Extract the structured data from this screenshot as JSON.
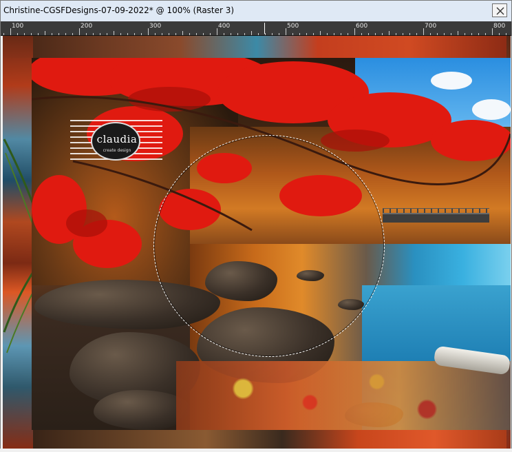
{
  "window": {
    "title": "Christine-CGSFDesigns-07-09-2022* @ 100% (Raster 3)",
    "close_icon": "close-icon"
  },
  "ruler": {
    "labels": [
      "100",
      "200",
      "300",
      "400",
      "500",
      "600",
      "700",
      "800"
    ]
  },
  "canvas": {
    "watermark_text": "claudia",
    "watermark_subtext": "create design",
    "selection_shape": "circle",
    "colors": {
      "frame_red": "#c2401b",
      "frame_blue": "#3c8aa7",
      "sky_blue": "#2a8ee0",
      "water_teal": "#39b0e0",
      "leaf_red": "#e01a10"
    }
  }
}
